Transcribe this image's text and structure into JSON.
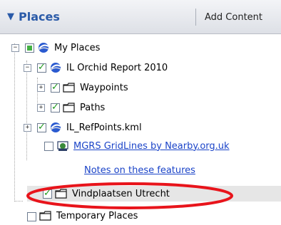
{
  "header": {
    "title": "Places",
    "add_content_label": "Add Content"
  },
  "tree": {
    "my_places": "My Places",
    "il_orchid_report": "IL Orchid Report 2010",
    "waypoints": "Waypoints",
    "paths": "Paths",
    "il_refpoints": "IL_RefPoints.kml",
    "mgrs_gridlines": "MGRS GridLines by Nearby.org.uk",
    "notes_link": "Notes on these features",
    "vindplaatsen": "Vindplaatsen Utrecht",
    "temporary_places": "Temporary Places"
  },
  "colors": {
    "header_text": "#2a5aa8",
    "link": "#1b44c8",
    "check_green": "#1e9a1e",
    "highlight_oval": "#e8141b"
  },
  "icons": {
    "header_toggle": "collapse-triangle-icon",
    "globe": "google-earth-globe-icon",
    "folder": "folder-icon",
    "network_link": "network-link-icon"
  }
}
